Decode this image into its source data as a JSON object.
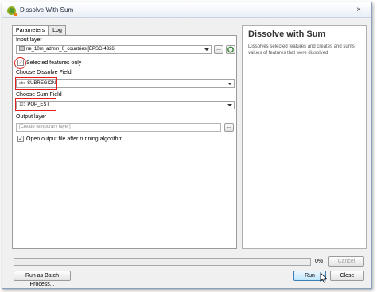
{
  "window": {
    "title": "Dissolve With Sum",
    "close_glyph": "×"
  },
  "tabs": [
    {
      "label": "Parameters"
    },
    {
      "label": "Log"
    }
  ],
  "params": {
    "input_layer_label": "Input layer",
    "input_layer_value": "ne_10m_admin_0_countries [EPSG:4326]",
    "input_layer_icon": "polygon-layer-icon",
    "browse_glyph": "...",
    "iterate_icon": "iterate-icon",
    "selected_only_label": "Selected features only",
    "selected_only_checked": true,
    "dissolve_field_label": "Choose Dissolve Field",
    "dissolve_field_type": "abc",
    "dissolve_field_value": "SUBREGION",
    "sum_field_label": "Choose Sum Field",
    "sum_field_type": "123",
    "sum_field_value": "POP_EST",
    "output_layer_label": "Output layer",
    "output_layer_placeholder": "[Create temporary layer]",
    "open_output_label": "Open output file after running algorithm",
    "open_output_checked": true
  },
  "help": {
    "title": "Dissolve with Sum",
    "description": "Dissolves selected features and creates and sums values of features that were dissolved"
  },
  "progress": {
    "value": 0,
    "label": "0%"
  },
  "buttons": {
    "cancel": "Cancel",
    "batch": "Run as Batch Process...",
    "run": "Run",
    "close": "Close"
  },
  "colors": {
    "highlight": "#e02020",
    "progress": "#3f9d38",
    "qgis_green": "#589632"
  }
}
